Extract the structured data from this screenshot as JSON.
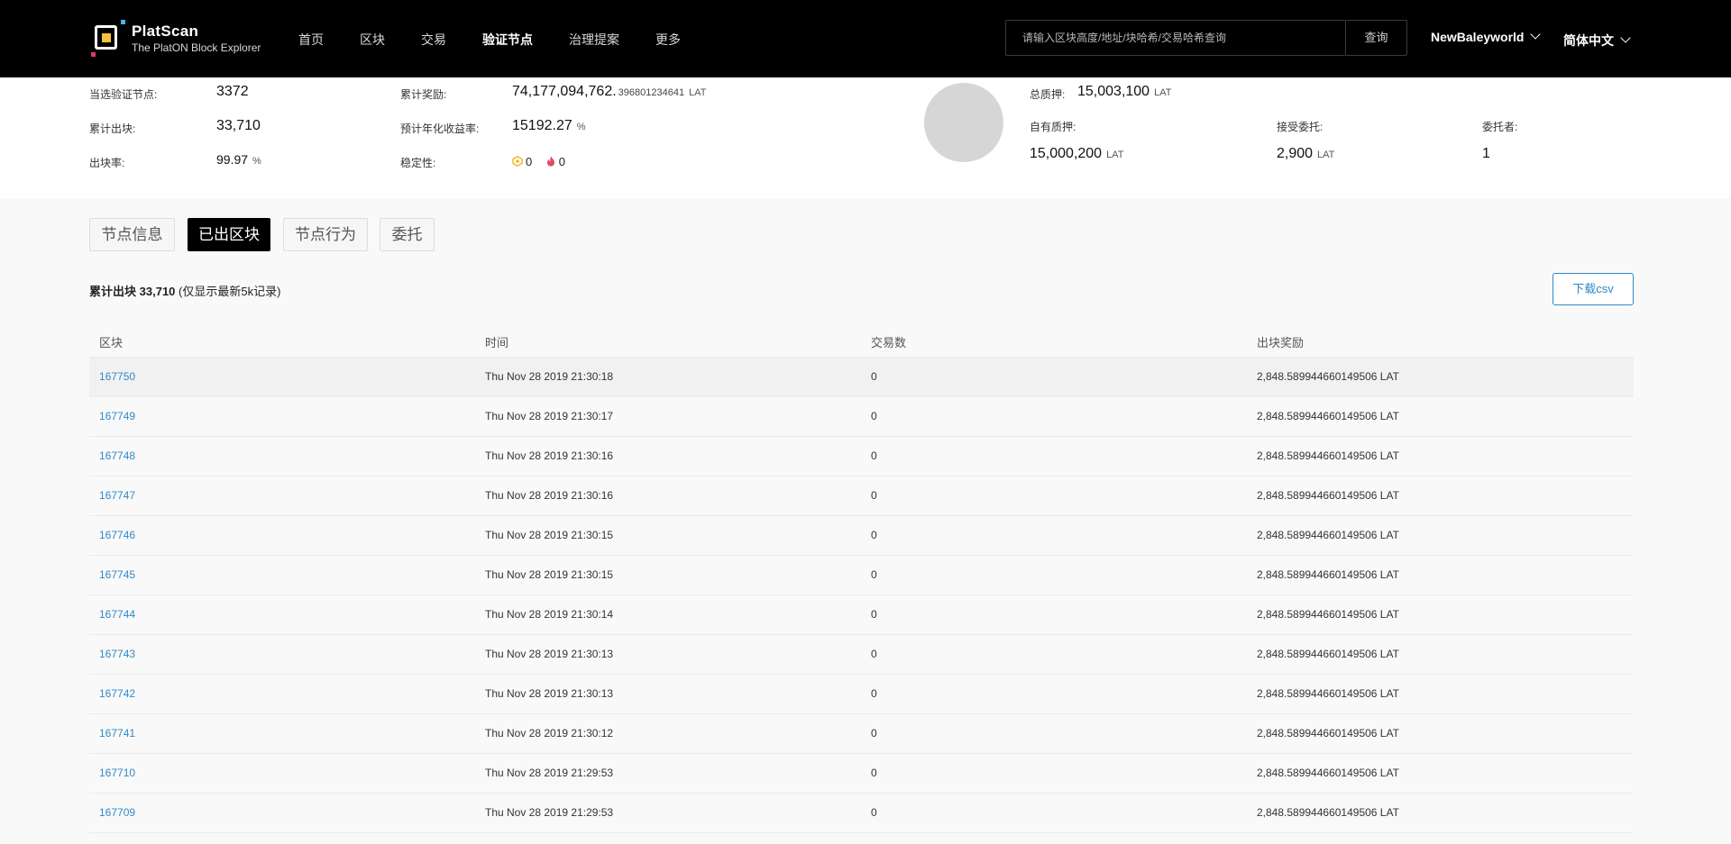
{
  "header": {
    "brand_name": "PlatScan",
    "brand_sub": "The PlatON Block Explorer",
    "nav": [
      "首页",
      "区块",
      "交易",
      "验证节点",
      "治理提案",
      "更多"
    ],
    "active_nav": "验证节点",
    "search_placeholder": "请输入区块高度/地址/块哈希/交易哈希查询",
    "search_button": "查询",
    "network": "NewBaleyworld",
    "language": "简体中文"
  },
  "stats": {
    "elected_label": "当选验证节点:",
    "elected_value": "3372",
    "blocks_label": "累计出块:",
    "blocks_value": "33,710",
    "rate_label": "出块率:",
    "rate_value": "99.97",
    "rate_unit": "%",
    "reward_label": "累计奖励:",
    "reward_int": "74,177,094,762.",
    "reward_dec": "396801234641",
    "reward_unit": "LAT",
    "apy_label": "预计年化收益率:",
    "apy_value": "15192.27",
    "apy_unit": "%",
    "stability_label": "稳定性:",
    "stability_low": "0",
    "stability_slash": "0",
    "total_stake_label": "总质押:",
    "total_stake_value": "15,003,100",
    "total_stake_unit": "LAT",
    "own_stake_label": "自有质押:",
    "own_stake_value": "15,000,200",
    "own_stake_unit": "LAT",
    "delegated_label": "接受委托:",
    "delegated_value": "2,900",
    "delegated_unit": "LAT",
    "delegators_label": "委托者:",
    "delegators_value": "1"
  },
  "tabs": [
    "节点信息",
    "已出区块",
    "节点行为",
    "委托"
  ],
  "active_tab": "已出区块",
  "summary": {
    "label": "累计出块",
    "count": "33,710",
    "note": "(仅显示最新5k记录)"
  },
  "download_label": "下载csv",
  "table": {
    "columns": [
      "区块",
      "时间",
      "交易数",
      "出块奖励"
    ],
    "rows": [
      {
        "block": "167750",
        "time": "Thu Nov 28 2019 21:30:18",
        "txs": "0",
        "reward": "2,848.589944660149506 LAT"
      },
      {
        "block": "167749",
        "time": "Thu Nov 28 2019 21:30:17",
        "txs": "0",
        "reward": "2,848.589944660149506 LAT"
      },
      {
        "block": "167748",
        "time": "Thu Nov 28 2019 21:30:16",
        "txs": "0",
        "reward": "2,848.589944660149506 LAT"
      },
      {
        "block": "167747",
        "time": "Thu Nov 28 2019 21:30:16",
        "txs": "0",
        "reward": "2,848.589944660149506 LAT"
      },
      {
        "block": "167746",
        "time": "Thu Nov 28 2019 21:30:15",
        "txs": "0",
        "reward": "2,848.589944660149506 LAT"
      },
      {
        "block": "167745",
        "time": "Thu Nov 28 2019 21:30:15",
        "txs": "0",
        "reward": "2,848.589944660149506 LAT"
      },
      {
        "block": "167744",
        "time": "Thu Nov 28 2019 21:30:14",
        "txs": "0",
        "reward": "2,848.589944660149506 LAT"
      },
      {
        "block": "167743",
        "time": "Thu Nov 28 2019 21:30:13",
        "txs": "0",
        "reward": "2,848.589944660149506 LAT"
      },
      {
        "block": "167742",
        "time": "Thu Nov 28 2019 21:30:13",
        "txs": "0",
        "reward": "2,848.589944660149506 LAT"
      },
      {
        "block": "167741",
        "time": "Thu Nov 28 2019 21:30:12",
        "txs": "0",
        "reward": "2,848.589944660149506 LAT"
      },
      {
        "block": "167710",
        "time": "Thu Nov 28 2019 21:29:53",
        "txs": "0",
        "reward": "2,848.589944660149506 LAT"
      },
      {
        "block": "167709",
        "time": "Thu Nov 28 2019 21:29:53",
        "txs": "0",
        "reward": "2,848.589944660149506 LAT"
      }
    ]
  },
  "colors": {
    "header_bg": "#000000",
    "link": "#2f89c8",
    "stability_low": "#f0b41c",
    "stability_slash": "#e5466a"
  }
}
